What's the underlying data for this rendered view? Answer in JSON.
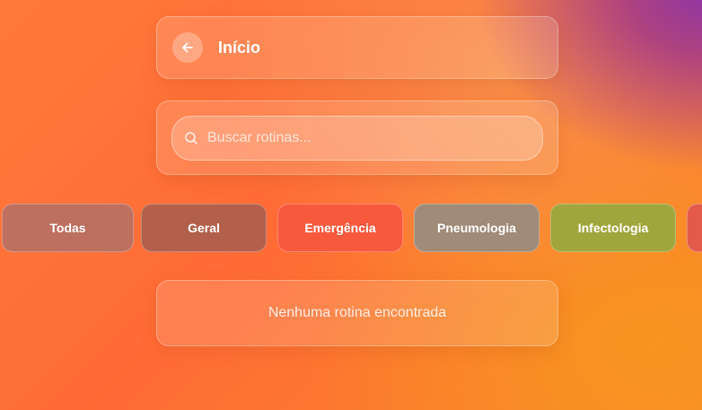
{
  "header": {
    "title": "Início",
    "back_icon": "arrow-left-icon"
  },
  "search": {
    "placeholder": "Buscar rotinas...",
    "value": "",
    "icon": "search-icon"
  },
  "filters": [
    {
      "label": "Todas",
      "color": "#bd6f60"
    },
    {
      "label": "Geral",
      "color": "#b2604c"
    },
    {
      "label": "Emergência",
      "color": "#f7593c"
    },
    {
      "label": "Pneumologia",
      "color": "#9f8b78"
    },
    {
      "label": "Infectologia",
      "color": "#a0a63c"
    },
    {
      "label": "",
      "color": "#e35a4a"
    }
  ],
  "empty_state": {
    "message": "Nenhuma rotina encontrada"
  }
}
